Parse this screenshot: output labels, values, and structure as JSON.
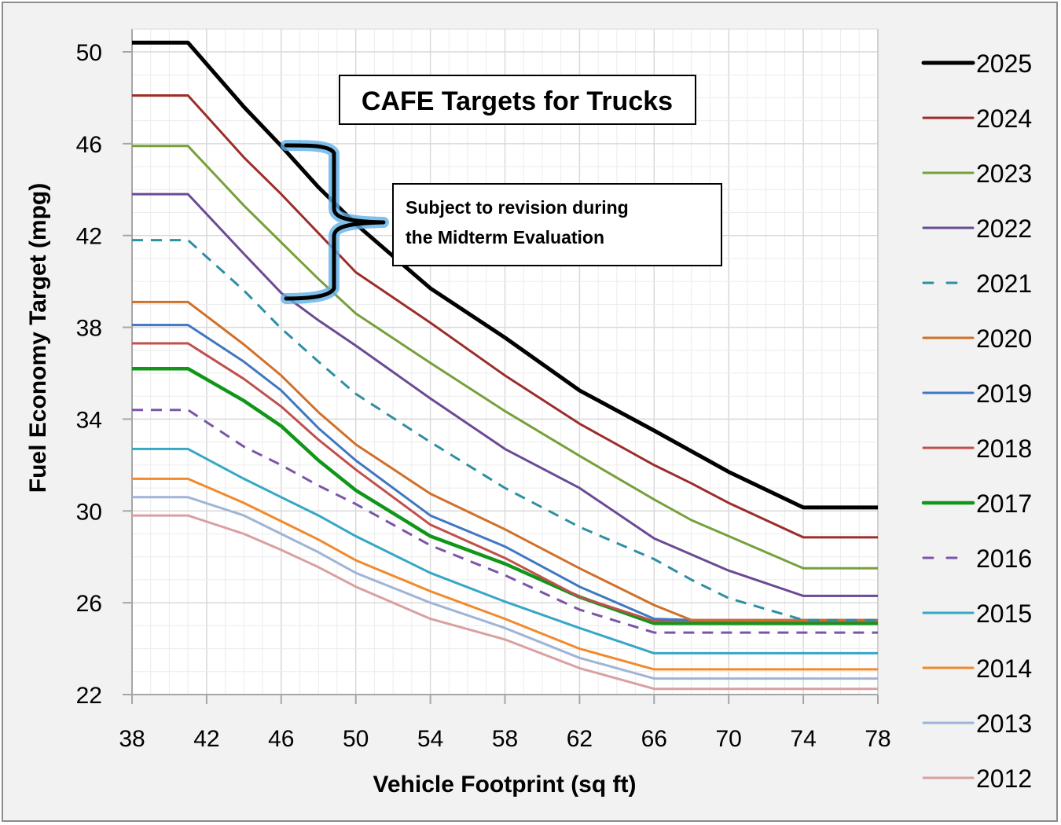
{
  "chart_data": {
    "type": "line",
    "title": "CAFE Targets for Trucks",
    "annotation": "Subject to revision during the Midterm Evaluation",
    "annotation_lines": [
      "Subject to revision during",
      "the Midterm Evaluation"
    ],
    "annotation_brace_spans": [
      "2025",
      "2024",
      "2023",
      "2022"
    ],
    "xlabel": "Vehicle Footprint (sq ft)",
    "ylabel": "Fuel Economy Target (mpg)",
    "xlim": [
      38,
      78
    ],
    "ylim": [
      22,
      51
    ],
    "xticks": [
      38,
      42,
      46,
      50,
      54,
      58,
      62,
      66,
      70,
      74,
      78
    ],
    "yticks": [
      22,
      26,
      30,
      34,
      38,
      42,
      46,
      50
    ],
    "grid": true,
    "minor_grid": true,
    "legend_position": "right",
    "x": [
      38,
      41,
      44,
      46,
      48,
      50,
      54,
      58,
      62,
      66,
      68,
      70,
      74,
      78
    ],
    "series": [
      {
        "name": "2025",
        "color": "#000000",
        "style": "solid",
        "weight": "bold",
        "values": [
          50.4,
          50.4,
          47.6,
          45.9,
          44.1,
          42.5,
          39.7,
          37.55,
          35.25,
          33.5,
          32.6,
          31.7,
          30.15,
          30.15
        ]
      },
      {
        "name": "2024",
        "color": "#9b2d2a",
        "style": "solid",
        "weight": "normal",
        "values": [
          48.1,
          48.1,
          45.4,
          43.8,
          42.1,
          40.4,
          38.2,
          35.9,
          33.8,
          32.0,
          31.2,
          30.35,
          28.85,
          28.85
        ]
      },
      {
        "name": "2023",
        "color": "#77a03c",
        "style": "solid",
        "weight": "normal",
        "values": [
          45.9,
          45.9,
          43.3,
          41.7,
          40.1,
          38.6,
          36.45,
          34.35,
          32.4,
          30.5,
          29.6,
          28.9,
          27.5,
          27.5
        ]
      },
      {
        "name": "2022",
        "color": "#6a4a94",
        "style": "solid",
        "weight": "normal",
        "values": [
          43.8,
          43.8,
          41.2,
          39.5,
          38.3,
          37.2,
          34.9,
          32.7,
          31.0,
          28.8,
          28.1,
          27.4,
          26.3,
          26.3
        ]
      },
      {
        "name": "2021",
        "color": "#2e8fa3",
        "style": "dashed",
        "weight": "normal",
        "values": [
          41.8,
          41.8,
          39.6,
          37.95,
          36.5,
          35.1,
          33.0,
          31.0,
          29.3,
          27.9,
          27.0,
          26.2,
          25.25,
          25.25
        ]
      },
      {
        "name": "2020",
        "color": "#d0702a",
        "style": "solid",
        "weight": "normal",
        "values": [
          39.1,
          39.1,
          37.25,
          35.9,
          34.3,
          32.9,
          30.75,
          29.2,
          27.5,
          25.9,
          25.25,
          25.25,
          25.25,
          25.25
        ]
      },
      {
        "name": "2019",
        "color": "#3f78c2",
        "style": "solid",
        "weight": "normal",
        "values": [
          38.1,
          38.1,
          36.5,
          35.25,
          33.6,
          32.2,
          29.8,
          28.45,
          26.7,
          25.3,
          25.25,
          25.25,
          25.25,
          25.25
        ]
      },
      {
        "name": "2018",
        "color": "#c0504d",
        "style": "solid",
        "weight": "normal",
        "values": [
          37.3,
          37.3,
          35.75,
          34.55,
          33.1,
          31.8,
          29.4,
          27.95,
          26.25,
          25.2,
          25.2,
          25.2,
          25.2,
          25.2
        ]
      },
      {
        "name": "2017",
        "color": "#109618",
        "style": "solid",
        "weight": "bold",
        "values": [
          36.2,
          36.2,
          34.8,
          33.7,
          32.2,
          30.9,
          28.9,
          27.7,
          26.25,
          25.1,
          25.1,
          25.1,
          25.1,
          25.1
        ]
      },
      {
        "name": "2016",
        "color": "#7b55a8",
        "style": "dashed",
        "weight": "normal",
        "values": [
          34.4,
          34.4,
          32.8,
          32.0,
          31.1,
          30.3,
          28.5,
          27.2,
          25.7,
          24.7,
          24.7,
          24.7,
          24.7,
          24.7
        ]
      },
      {
        "name": "2015",
        "color": "#36a7c6",
        "style": "solid",
        "weight": "normal",
        "values": [
          32.7,
          32.7,
          31.4,
          30.6,
          29.8,
          28.9,
          27.3,
          26.05,
          24.9,
          23.8,
          23.8,
          23.8,
          23.8,
          23.8
        ]
      },
      {
        "name": "2014",
        "color": "#f08a2c",
        "style": "solid",
        "weight": "normal",
        "values": [
          31.4,
          31.4,
          30.35,
          29.55,
          28.75,
          27.85,
          26.5,
          25.3,
          24.0,
          23.1,
          23.1,
          23.1,
          23.1,
          23.1
        ]
      },
      {
        "name": "2013",
        "color": "#9fb4d6",
        "style": "solid",
        "weight": "normal",
        "values": [
          30.6,
          30.6,
          29.8,
          29.0,
          28.2,
          27.3,
          26.0,
          24.9,
          23.6,
          22.7,
          22.7,
          22.7,
          22.7,
          22.7
        ]
      },
      {
        "name": "2012",
        "color": "#d9a0a0",
        "style": "solid",
        "weight": "normal",
        "values": [
          29.8,
          29.8,
          29.0,
          28.3,
          27.55,
          26.7,
          25.3,
          24.4,
          23.15,
          22.25,
          22.25,
          22.25,
          22.25,
          22.25
        ]
      }
    ]
  }
}
